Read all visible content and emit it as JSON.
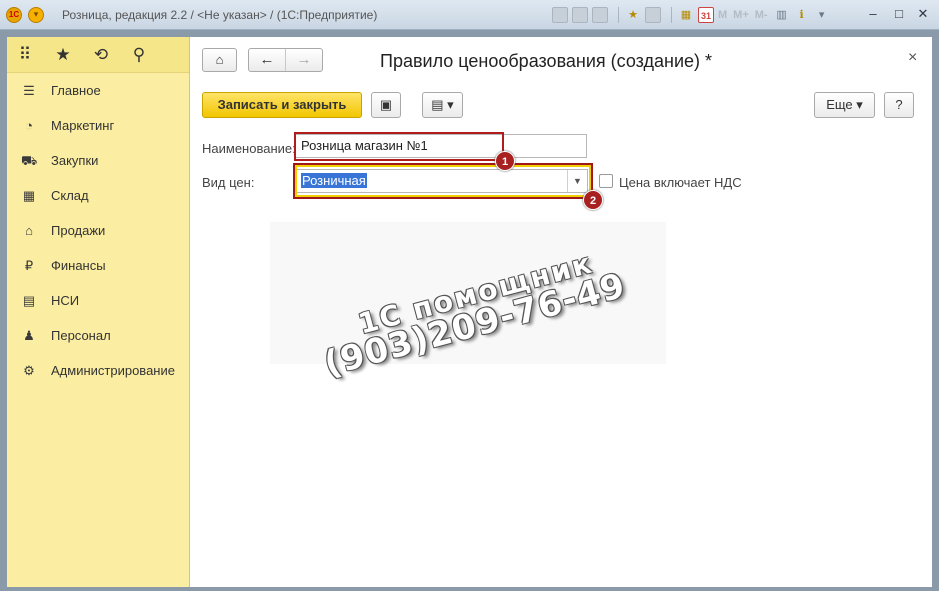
{
  "window": {
    "title": "Розница, редакция 2.2 / <Не указан> / (1С:Предприятие)",
    "toolbar_m": [
      "M",
      "M+",
      "M-"
    ],
    "calendar_day": "31"
  },
  "sidebar": {
    "top_icons": [
      "apps-grid-icon",
      "favorites-star-icon",
      "history-icon",
      "search-icon"
    ],
    "items": [
      {
        "label": "Главное",
        "icon": "menu-lines-icon"
      },
      {
        "label": "Маркетинг",
        "icon": "pie-chart-icon"
      },
      {
        "label": "Закупки",
        "icon": "cart-icon"
      },
      {
        "label": "Склад",
        "icon": "warehouse-icon"
      },
      {
        "label": "Продажи",
        "icon": "basket-icon"
      },
      {
        "label": "Финансы",
        "icon": "ruble-icon"
      },
      {
        "label": "НСИ",
        "icon": "reference-book-icon"
      },
      {
        "label": "Персонал",
        "icon": "person-icon"
      },
      {
        "label": "Администрирование",
        "icon": "gear-icon"
      }
    ]
  },
  "form": {
    "title": "Правило ценообразования (создание) *",
    "close_symbol": "×",
    "save_close_label": "Записать и закрыть",
    "more_label": "Еще",
    "help_label": "?",
    "name_label": "Наименование:",
    "name_value": "Розница магазин №1",
    "price_type_label": "Вид цен:",
    "price_type_value": "Розничная",
    "vat_label": "Цена включает НДС",
    "vat_checked": false
  },
  "annotations": {
    "badge1": "1",
    "badge2": "2",
    "highlight_color": "#b01c1c"
  },
  "watermark": {
    "line1": "1С помощник",
    "line2": "(903)209-76-49"
  },
  "colors": {
    "accent": "#f2c600",
    "sidebar_bg": "#fbeea2",
    "selection": "#3875d7"
  }
}
